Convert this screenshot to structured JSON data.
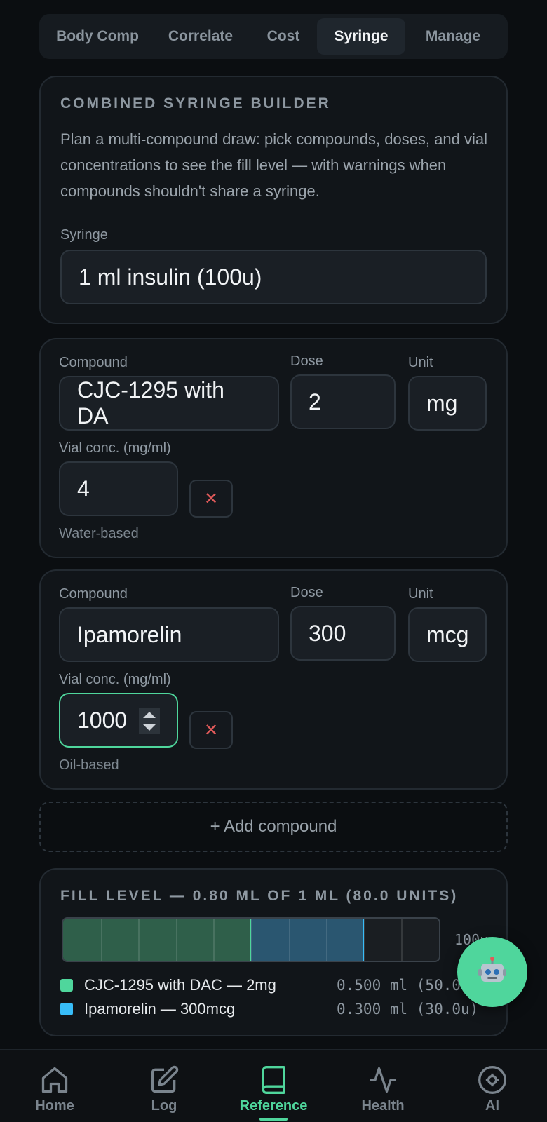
{
  "tabs": [
    {
      "label": "Body Comp",
      "active": false
    },
    {
      "label": "Correlate",
      "active": false
    },
    {
      "label": "Cost",
      "active": false
    },
    {
      "label": "Syringe",
      "active": true
    },
    {
      "label": "Manage",
      "active": false
    }
  ],
  "builder": {
    "title": "COMBINED SYRINGE BUILDER",
    "description": "Plan a multi-compound draw: pick compounds, doses, and vial concentrations to see the fill level — with warnings when compounds shouldn't share a syringe.",
    "syringe_label": "Syringe",
    "syringe_value": "1 ml insulin (100u)"
  },
  "compounds": [
    {
      "compound_label": "Compound",
      "compound": "CJC-1295 with DA",
      "dose_label": "Dose",
      "dose": "2",
      "unit_label": "Unit",
      "unit": "mg",
      "vial_label": "Vial conc. (mg/ml)",
      "vial": "4",
      "remove": "✕",
      "base": "Water-based"
    },
    {
      "compound_label": "Compound",
      "compound": "Ipamorelin",
      "dose_label": "Dose",
      "dose": "300",
      "unit_label": "Unit",
      "unit": "mcg",
      "vial_label": "Vial conc. (mg/ml)",
      "vial": "1000",
      "remove": "✕",
      "base": "Oil-based"
    }
  ],
  "add_compound": "+ Add compound",
  "fill": {
    "title": "FILL LEVEL — 0.80 ML OF 1 ML (80.0 UNITS)",
    "scale_label": "100u",
    "capacity_units": 100,
    "segments": [
      {
        "name": "CJC-1295 with DAC — 2mg",
        "value": "0.500 ml (50.0u)",
        "units": 50,
        "color": "#2f5f4a",
        "marker": "#4fd69c"
      },
      {
        "name": "Ipamorelin — 300mcg",
        "value": "0.300 ml (30.0u)",
        "units": 30,
        "color": "#2a5670",
        "marker": "#38bdf8"
      }
    ]
  },
  "fab_icon": "robot-icon",
  "nav": [
    {
      "label": "Home",
      "icon": "home-icon",
      "active": false
    },
    {
      "label": "Log",
      "icon": "pencil-icon",
      "active": false
    },
    {
      "label": "Reference",
      "icon": "book-icon",
      "active": true
    },
    {
      "label": "Health",
      "icon": "activity-icon",
      "active": false
    },
    {
      "label": "AI",
      "icon": "ai-icon",
      "active": false
    }
  ],
  "colors": {
    "accent": "#4fd69c",
    "accent2": "#38bdf8",
    "danger": "#e05a5a"
  }
}
